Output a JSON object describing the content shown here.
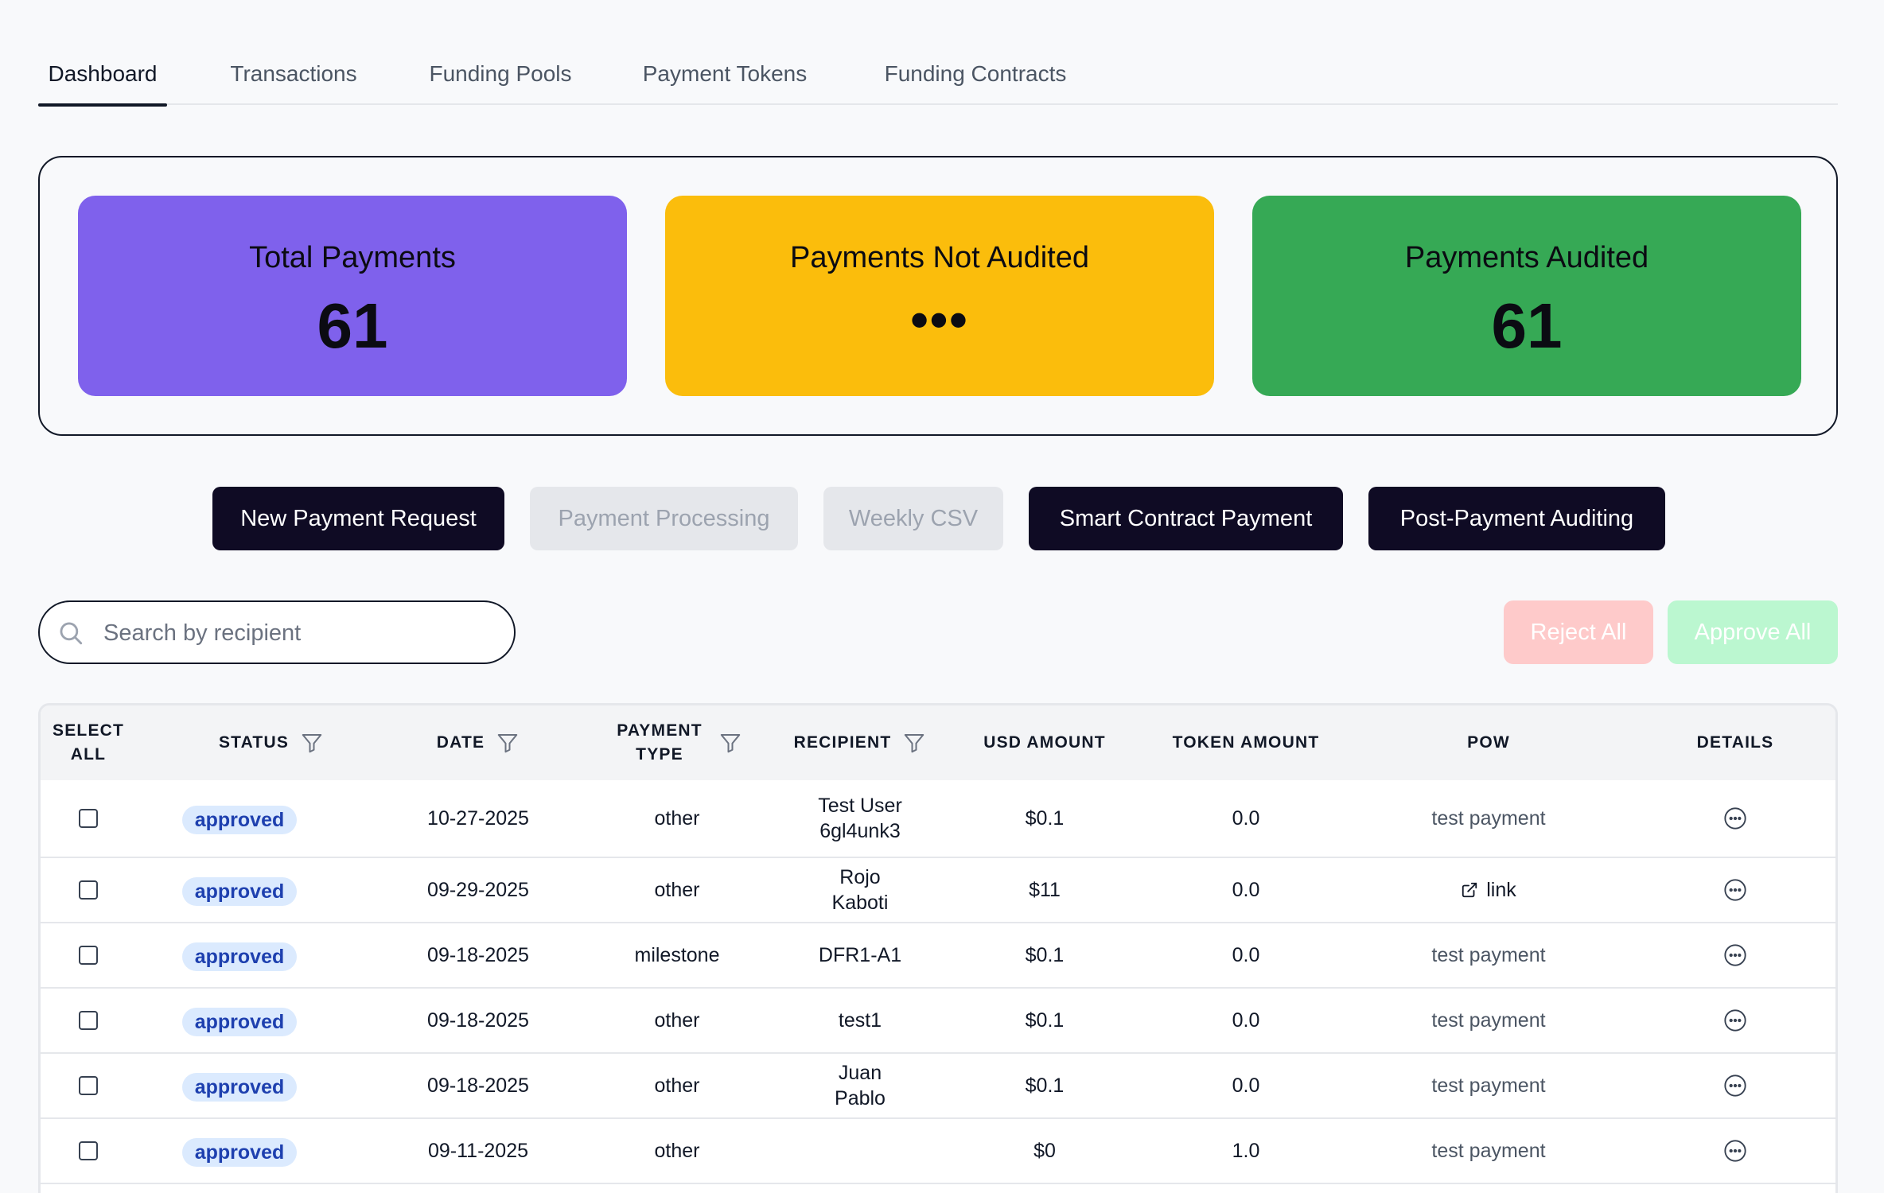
{
  "tabs": [
    {
      "label": "Dashboard",
      "active": true
    },
    {
      "label": "Transactions",
      "active": false
    },
    {
      "label": "Funding Pools",
      "active": false
    },
    {
      "label": "Payment Tokens",
      "active": false
    },
    {
      "label": "Funding Contracts",
      "active": false
    }
  ],
  "stats": {
    "total": {
      "title": "Total Payments",
      "value": "61",
      "color": "#7f61ec"
    },
    "not_audited": {
      "title": "Payments Not Audited",
      "value": "•••",
      "color": "#fbbd0c"
    },
    "audited": {
      "title": "Payments Audited",
      "value": "61",
      "color": "#36a955"
    }
  },
  "actions": {
    "new_payment_request": "New Payment Request",
    "payment_processing": "Payment Processing",
    "weekly_csv": "Weekly CSV",
    "smart_contract_payment": "Smart Contract Payment",
    "post_payment_auditing": "Post-Payment Auditing"
  },
  "search": {
    "placeholder": "Search by recipient",
    "value": ""
  },
  "bulk": {
    "reject_all": "Reject All",
    "approve_all": "Approve All"
  },
  "table": {
    "headers": {
      "select_all": "SELECT ALL",
      "status": "STATUS",
      "date": "DATE",
      "payment_type": "PAYMENT TYPE",
      "recipient": "RECIPIENT",
      "usd_amount": "USD AMOUNT",
      "token_amount": "TOKEN AMOUNT",
      "pow": "POW",
      "details": "DETAILS"
    },
    "rows": [
      {
        "status": "approved",
        "date": "10-27-2025",
        "type": "other",
        "recipient": "Test User 6gl4unk3",
        "usd": "$0.1",
        "token": "0.0",
        "pow": "test payment",
        "pow_is_link": false
      },
      {
        "status": "approved",
        "date": "09-29-2025",
        "type": "other",
        "recipient": "Rojo Kaboti",
        "usd": "$11",
        "token": "0.0",
        "pow": "link",
        "pow_is_link": true
      },
      {
        "status": "approved",
        "date": "09-18-2025",
        "type": "milestone",
        "recipient": "DFR1-A1",
        "usd": "$0.1",
        "token": "0.0",
        "pow": "test payment",
        "pow_is_link": false
      },
      {
        "status": "approved",
        "date": "09-18-2025",
        "type": "other",
        "recipient": "test1",
        "usd": "$0.1",
        "token": "0.0",
        "pow": "test payment",
        "pow_is_link": false
      },
      {
        "status": "approved",
        "date": "09-18-2025",
        "type": "other",
        "recipient": "Juan Pablo",
        "usd": "$0.1",
        "token": "0.0",
        "pow": "test payment",
        "pow_is_link": false
      },
      {
        "status": "approved",
        "date": "09-11-2025",
        "type": "other",
        "recipient": "",
        "usd": "$0",
        "token": "1.0",
        "pow": "test payment",
        "pow_is_link": false
      }
    ]
  }
}
